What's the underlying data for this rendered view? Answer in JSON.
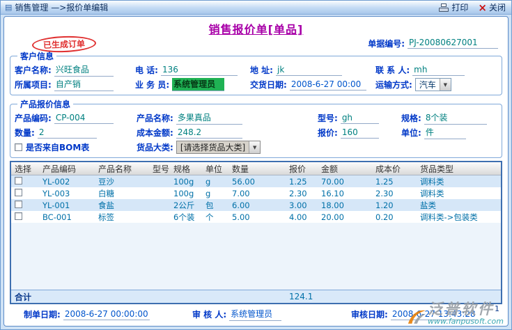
{
  "titlebar": {
    "title": "销售管理 —>报价单编辑",
    "print": "打印",
    "close": "关闭"
  },
  "header": {
    "title": "销售报价单[单品]",
    "stamp": "已生成订单",
    "doc_label": "单据编号:",
    "doc_value": "PJ-20080627001"
  },
  "customer": {
    "legend": "客户信息",
    "name_label": "客户名称:",
    "name_value": "兴旺食品",
    "phone_label": "电 话:",
    "phone_value": "136",
    "addr_label": "地 址:",
    "addr_value": "jk",
    "contact_label": "联 系 人:",
    "contact_value": "mh",
    "project_label": "所属项目:",
    "project_value": "自产销",
    "sales_label": "业 务 员:",
    "sales_value": "系统管理员",
    "deliver_label": "交货日期:",
    "deliver_value": "2008-6-27 00:00",
    "transport_label": "运输方式:",
    "transport_value": "汽车"
  },
  "product": {
    "legend": "产品报价信息",
    "code_label": "产品编码:",
    "code_value": "CP-004",
    "pname_label": "产品名称:",
    "pname_value": "多果真品",
    "model_label": "型号:",
    "model_value": "gh",
    "spec_label": "规格:",
    "spec_value": "8个装",
    "qty_label": "数量:",
    "qty_value": "2",
    "cost_label": "成本金额:",
    "cost_value": "248.2",
    "quote_label": "报价:",
    "quote_value": "160",
    "unit_label": "单位:",
    "unit_value": "件",
    "bom_label": "是否来自BOM表",
    "cat_label": "货品大类:",
    "cat_value": "[请选择货品大类]"
  },
  "table": {
    "headers": [
      "选择",
      "产品编码",
      "产品名称",
      "型号",
      "规格",
      "单位",
      "数量",
      "报价",
      "金额",
      "成本价",
      "货品类型"
    ],
    "rows": [
      {
        "code": "YL-002",
        "name": "豆沙",
        "model": "",
        "spec": "100g",
        "unit": "g",
        "qty": "56.00",
        "price": "1.25",
        "amount": "70.00",
        "cost": "1.25",
        "type": "调料类"
      },
      {
        "code": "YL-003",
        "name": "白糖",
        "model": "",
        "spec": "100g",
        "unit": "g",
        "qty": "7.00",
        "price": "2.30",
        "amount": "16.10",
        "cost": "2.30",
        "type": "调料类"
      },
      {
        "code": "YL-001",
        "name": "食盐",
        "model": "",
        "spec": "2公斤",
        "unit": "包",
        "qty": "6.00",
        "price": "3.00",
        "amount": "18.00",
        "cost": "1.20",
        "type": "盐类"
      },
      {
        "code": "BC-001",
        "name": "标签",
        "model": "",
        "spec": "6个装",
        "unit": "个",
        "qty": "5.00",
        "price": "4.00",
        "amount": "20.00",
        "cost": "0.20",
        "type": "调料类->包装类"
      }
    ],
    "total_label": "合计",
    "total_value": "124.1",
    "page": "1"
  },
  "footer": {
    "made_label": "制单日期:",
    "made_value": "2008-6-27 00:00:00",
    "auditor_label": "审 核 人:",
    "auditor_value": "系统管理员",
    "audit_date_label": "审核日期:",
    "audit_date_value": "2008-6-27 13:43:28"
  },
  "watermark": {
    "brand": "泛普软件",
    "url": "www.fanpusoft.com"
  }
}
